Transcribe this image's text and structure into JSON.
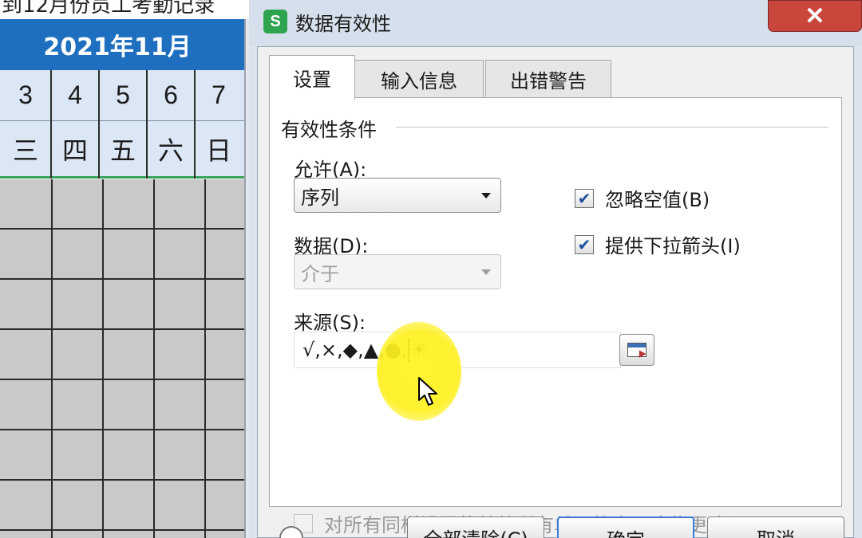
{
  "sheet": {
    "month_header": "2021年11月",
    "dates": [
      "3",
      "4",
      "5",
      "6",
      "7"
    ],
    "weekdays": [
      "三",
      "四",
      "五",
      "六",
      "日"
    ]
  },
  "dialog": {
    "title": "数据有效性",
    "app_icon_letter": "S",
    "close_glyph": "✕",
    "tabs": [
      {
        "label": "设置",
        "active": true
      },
      {
        "label": "输入信息",
        "active": false
      },
      {
        "label": "出错警告",
        "active": false
      }
    ],
    "group_title": "有效性条件",
    "allow": {
      "label": "允许(A):",
      "value": "序列"
    },
    "data": {
      "label": "数据(D):",
      "value": "介于",
      "disabled": true
    },
    "ignore_blank": {
      "label": "忽略空值(B)",
      "checked": true
    },
    "in_cell_dropdown": {
      "label": "提供下拉箭头(I)",
      "checked": true
    },
    "source": {
      "label": "来源(S):",
      "value_before_caret": "√,×,◆,▲,●,",
      "value_after_caret": "☀"
    },
    "apply_all": {
      "label": "对所有同样设置的其他所有单元格应用这些更改(P)",
      "checked": false,
      "disabled": true
    },
    "buttons": {
      "clear_all": "全部清除(C)",
      "ok": "确定",
      "cancel": "取消"
    }
  },
  "colors": {
    "month_header_bg": "#1e6fc0",
    "day_row_bg": "#dce7f5",
    "close_button": "#c9463d",
    "check_mark": "#1c4f9c",
    "cursor_highlight": "#fff028"
  }
}
